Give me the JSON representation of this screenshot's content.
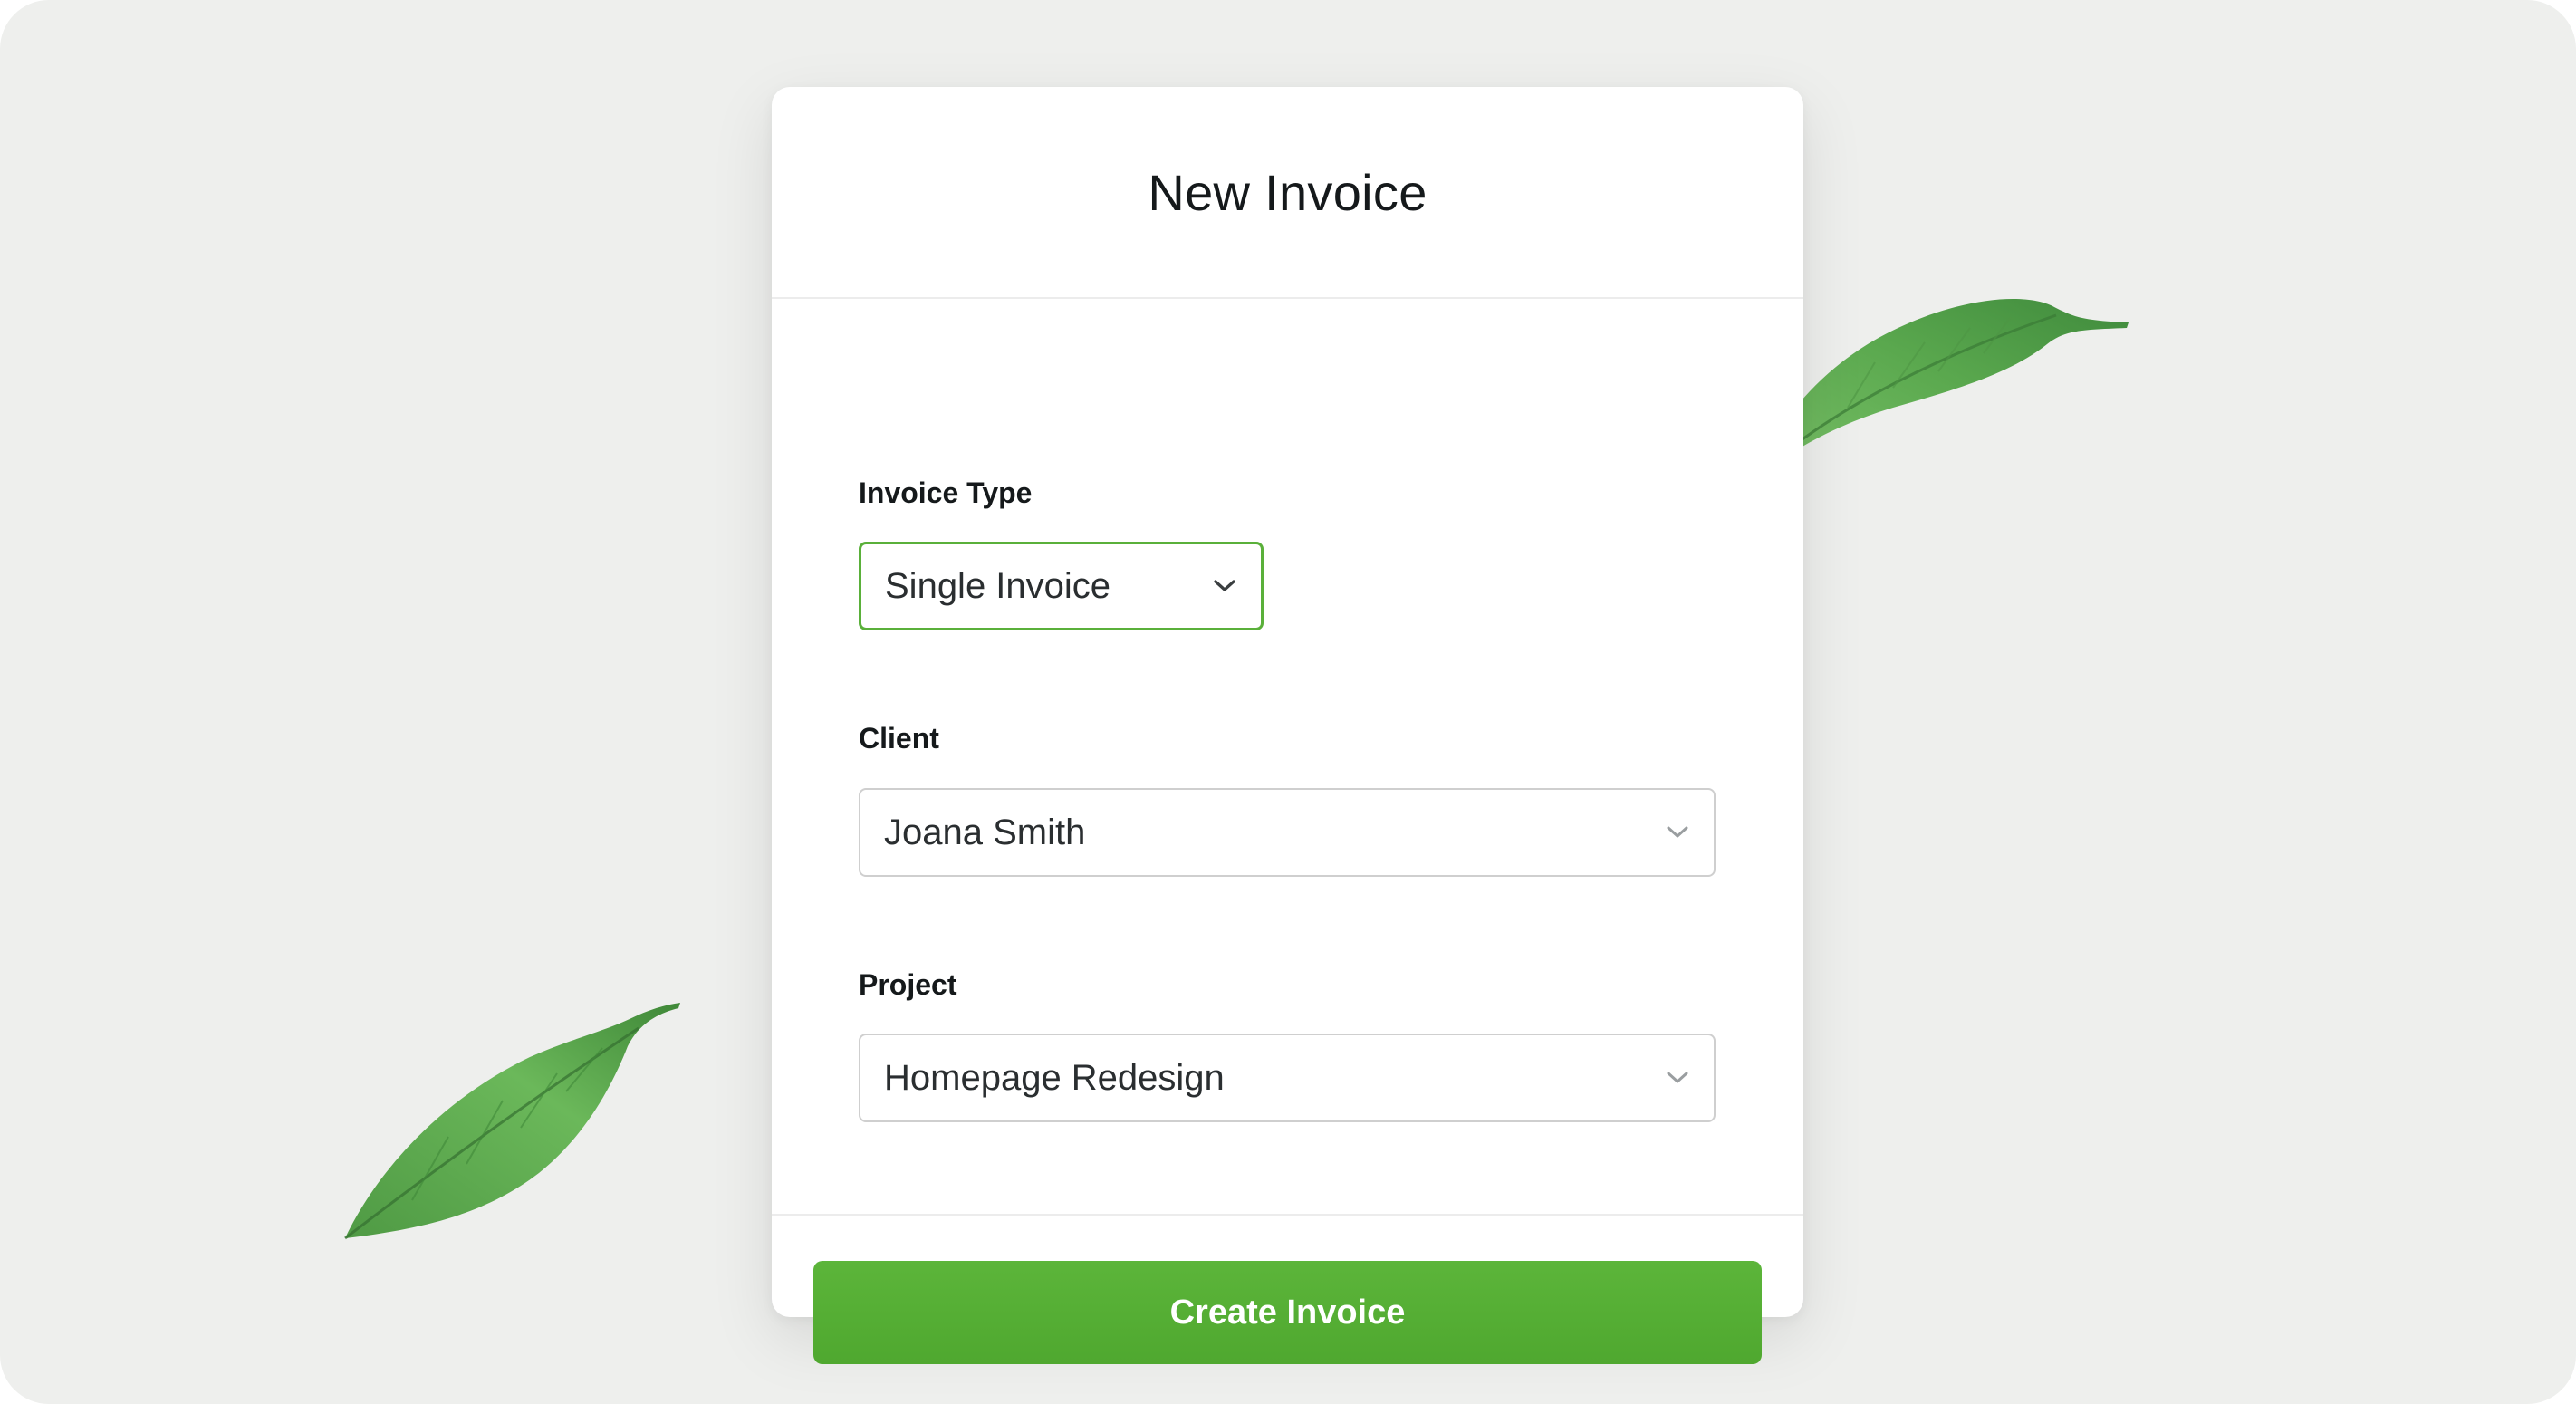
{
  "form": {
    "title": "New Invoice",
    "invoice_type": {
      "label": "Invoice Type",
      "value": "Single Invoice"
    },
    "client": {
      "label": "Client",
      "value": "Joana Smith"
    },
    "project": {
      "label": "Project",
      "value": "Homepage Redesign"
    },
    "submit_label": "Create Invoice"
  },
  "icons": {
    "select_arrow": "chevron-down-icon",
    "decoration": "leaf-icon"
  },
  "colors": {
    "accent": "#5ab03a",
    "background": "#eeefed",
    "text": "#15191b"
  }
}
